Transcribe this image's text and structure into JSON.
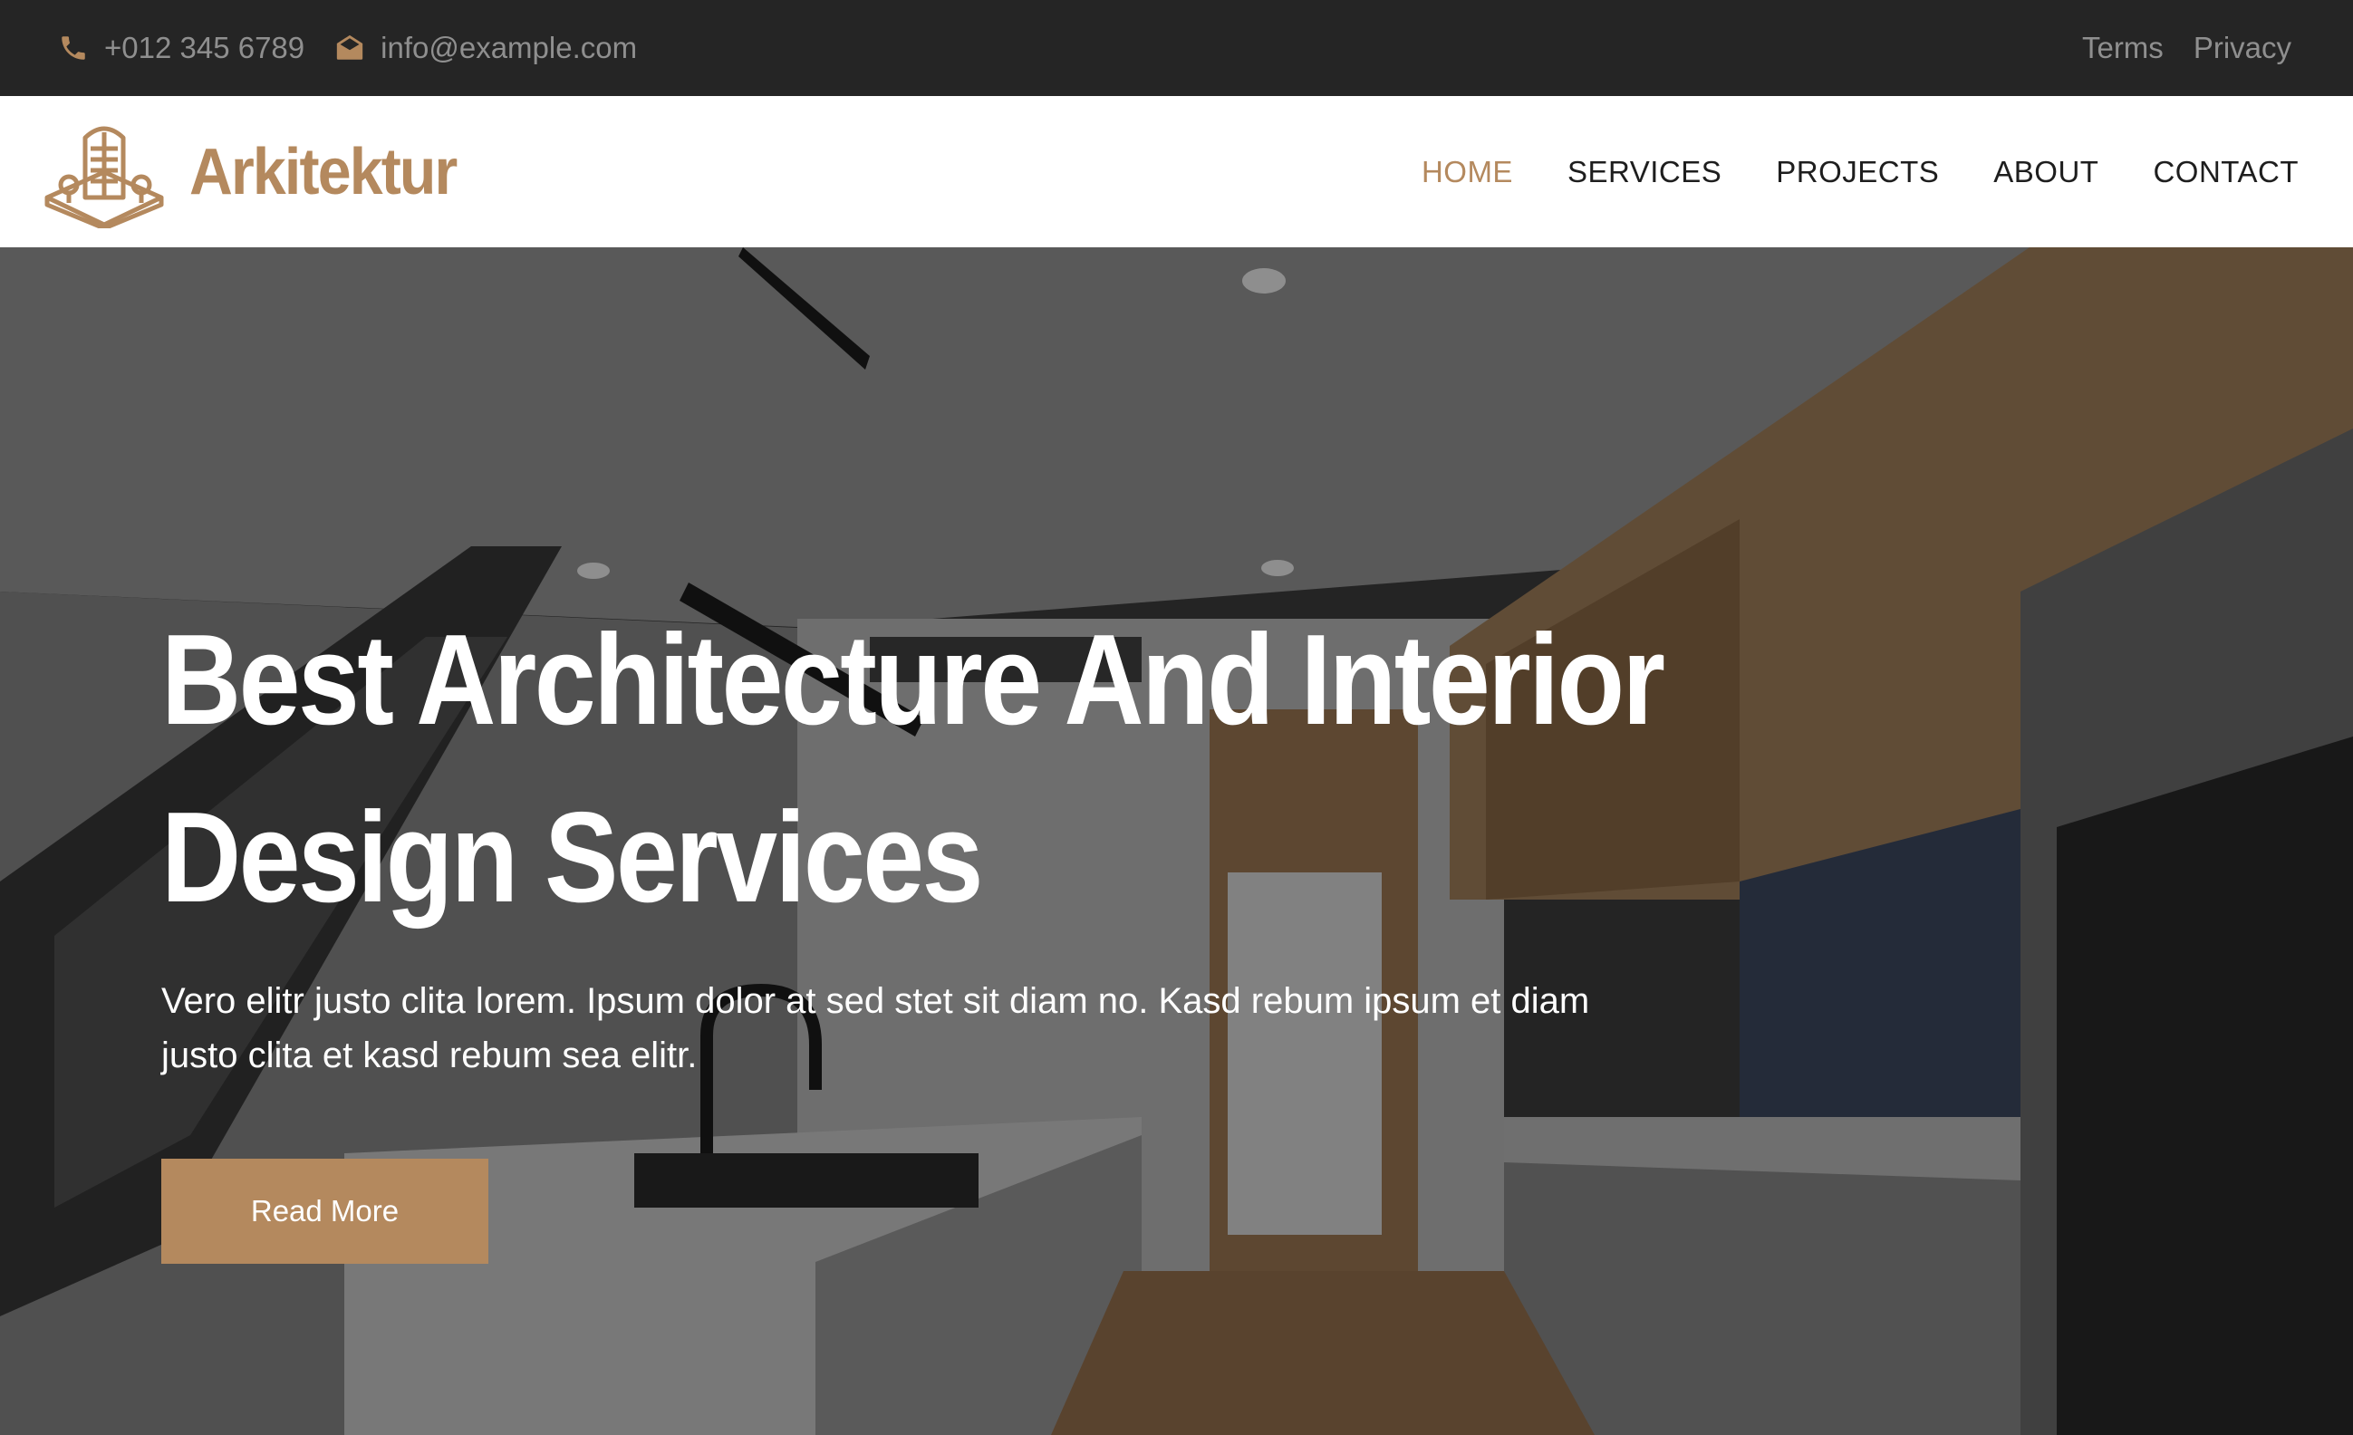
{
  "topbar": {
    "phone": "+012 345 6789",
    "email": "info@example.com",
    "links": [
      "Terms",
      "Privacy"
    ],
    "phone_icon": "phone-icon",
    "email_icon": "envelope-open-icon"
  },
  "brand": {
    "name": "Arkitektur",
    "logo_icon": "building-icon",
    "color": "#b4895e"
  },
  "nav": {
    "items": [
      "HOME",
      "SERVICES",
      "PROJECTS",
      "ABOUT",
      "CONTACT"
    ],
    "active": "HOME"
  },
  "hero": {
    "title_line1": "Best Architecture And Interior",
    "title_line2": "Design Services",
    "lead_line1": "Vero elitr justo clita lorem. Ipsum dolor at sed stet sit diam no. Kasd rebum ipsum et diam",
    "lead_line2": "justo clita et kasd rebum sea elitr.",
    "button_label": "Read More",
    "background": "modern kitchen interior photo",
    "accent_color": "#b4895e"
  }
}
